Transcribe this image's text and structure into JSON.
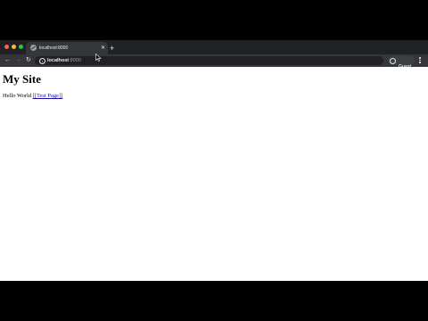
{
  "browser": {
    "tab": {
      "title": "localhost:8000",
      "close_glyph": "✕"
    },
    "new_tab_glyph": "+",
    "toolbar": {
      "back_glyph": "←",
      "forward_glyph": "→",
      "reload_glyph": "↻",
      "info_glyph": "i",
      "url_host": "localhost",
      "url_port": ":8000",
      "profile_label": "Guest"
    }
  },
  "page": {
    "heading": "My Site",
    "body_text": "Hello World ",
    "link_text": "[[Test Page]]"
  },
  "icons": {
    "traffic_lights": [
      "close-icon",
      "minimize-icon",
      "maximize-icon"
    ],
    "tab_favicon": "globe-icon",
    "menu": "kebab-menu-icon",
    "profile": "profile-icon",
    "cursor": "mouse-pointer-icon"
  },
  "colors": {
    "tabstrip": "#202124",
    "toolbar": "#35363a",
    "omnibox": "#202124",
    "link": "#1a0dab",
    "close": "#ff5f57",
    "minimize": "#febc2e",
    "maximize": "#28c840"
  }
}
